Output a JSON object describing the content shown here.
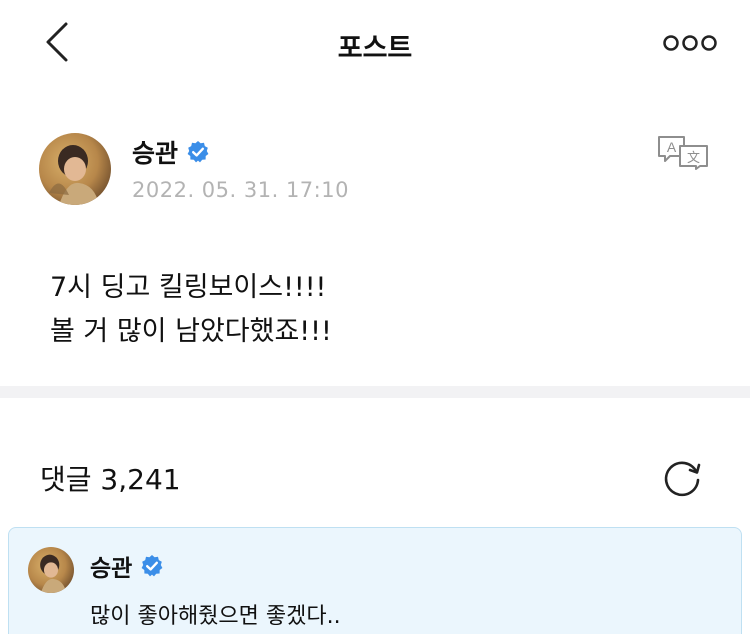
{
  "header": {
    "title": "포스트",
    "back_icon": "chevron-left-icon",
    "more_icon": "more-horizontal-icon"
  },
  "post": {
    "author": "승관",
    "verified_icon": "verified-badge-icon",
    "timestamp": "2022. 05. 31. 17:10",
    "translate_icon": "translate-icon",
    "lines": [
      "7시 딩고 킬링보이스!!!!",
      "볼 거 많이 남았다했죠!!!"
    ]
  },
  "comments": {
    "label": "댓글 3,241",
    "refresh_icon": "refresh-icon",
    "highlighted": {
      "author": "승관",
      "text": "많이 좋아해줬으면 좋겠다.."
    }
  },
  "colors": {
    "verified": "#3b8ee8",
    "timestamp": "#b3b3b3",
    "comment_bg": "#ebf6fd",
    "comment_border": "#bfe0f2",
    "divider": "#f2f2f4"
  }
}
